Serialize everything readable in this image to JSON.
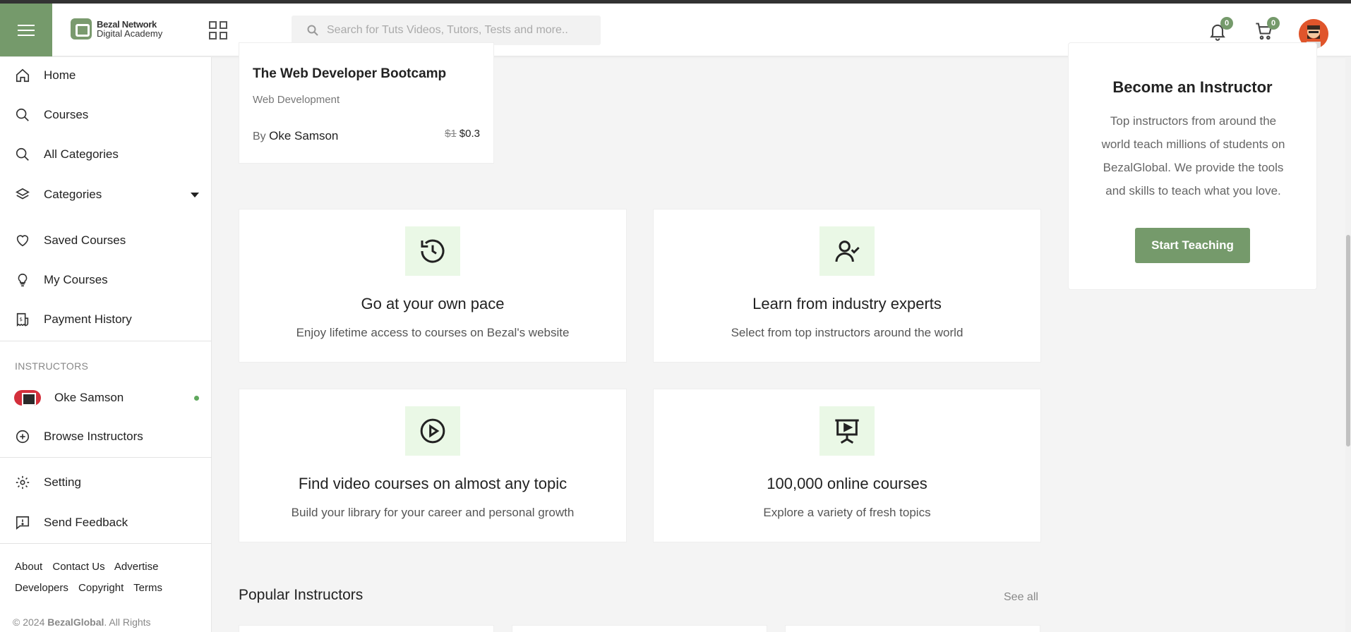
{
  "header": {
    "logo_line1": "Bezal Network",
    "logo_line2": "Digital Academy",
    "search_placeholder": "Search for Tuts Videos, Tutors, Tests and more..",
    "notifications_count": "0",
    "cart_count": "0"
  },
  "sidebar": {
    "items": [
      {
        "label": "Home"
      },
      {
        "label": "Courses"
      },
      {
        "label": "All Categories"
      },
      {
        "label": "Categories"
      },
      {
        "label": "Saved Courses"
      },
      {
        "label": "My Courses"
      },
      {
        "label": "Payment History"
      }
    ],
    "instructors_heading": "INSTRUCTORS",
    "instructor_name": "Oke Samson",
    "browse_instructors": "Browse Instructors",
    "setting": "Setting",
    "send_feedback": "Send Feedback",
    "footer_links_row1": [
      "About",
      "Contact Us",
      "Advertise"
    ],
    "footer_links_row2": [
      "Developers",
      "Copyright",
      "Terms"
    ],
    "copyright_prefix": "© 2024 ",
    "copyright_brand": "BezalGlobal",
    "copyright_suffix": ". All Rights"
  },
  "course_card": {
    "title": "The Web Developer Bootcamp",
    "category": "Web Development",
    "by": "By ",
    "author": "Oke Samson",
    "old_price": "$1",
    "price": "$0.3"
  },
  "features": [
    {
      "title": "Go at your own pace",
      "desc": "Enjoy lifetime access to courses on Bezal's website",
      "icon": "history-icon"
    },
    {
      "title": "Learn from industry experts",
      "desc": "Select from top instructors around the world",
      "icon": "user-check-icon"
    },
    {
      "title": "Find video courses on almost any topic",
      "desc": "Build your library for your career and personal growth",
      "icon": "play-circle-icon"
    },
    {
      "title": "100,000 online courses",
      "desc": "Explore a variety of fresh topics",
      "icon": "presentation-icon"
    }
  ],
  "popular": {
    "title": "Popular Instructors",
    "see_all": "See all"
  },
  "instructor_cta": {
    "title": "Become an Instructor",
    "desc": "Top instructors from around the world teach millions of students on BezalGlobal. We provide the tools and skills to teach what you love.",
    "button": "Start Teaching"
  },
  "colors": {
    "accent": "#759a6b",
    "feature_icon_bg": "#eaf8e6"
  }
}
